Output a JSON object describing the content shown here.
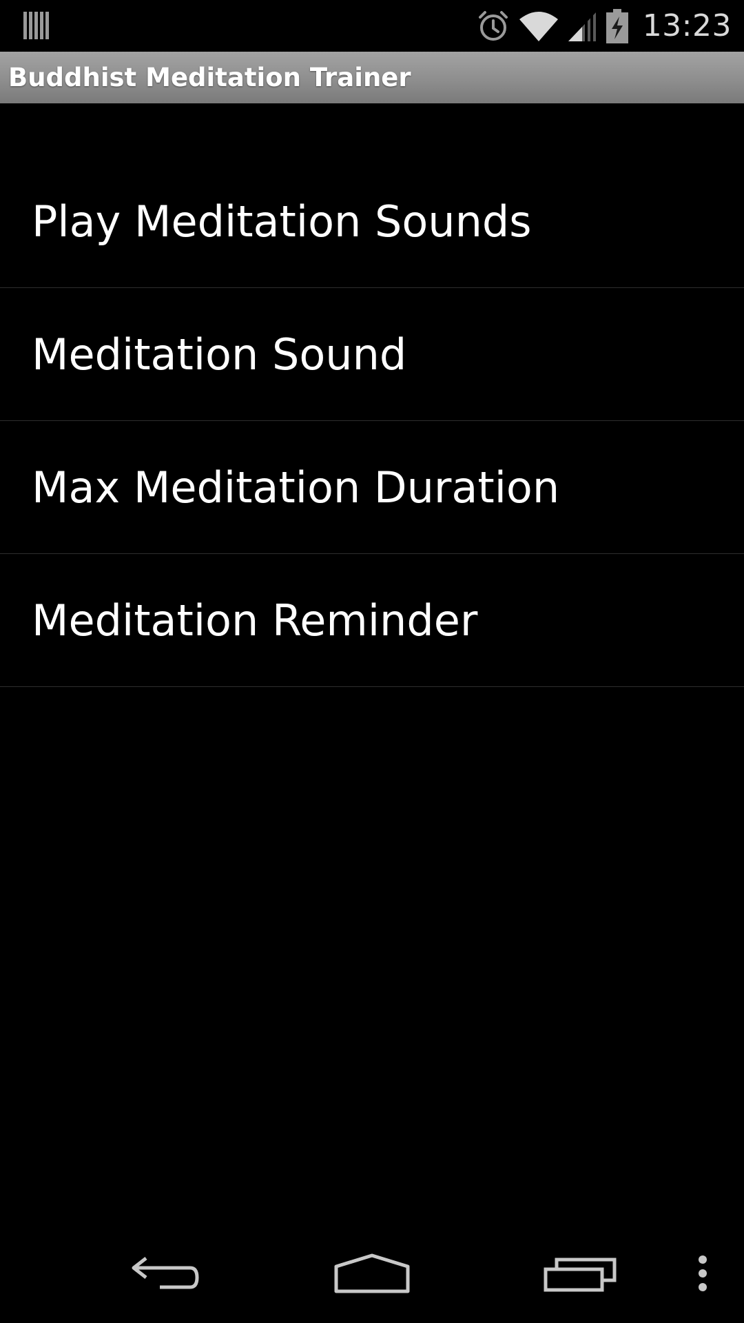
{
  "status_bar": {
    "time": "13:23",
    "icons": [
      "notification-bars-icon",
      "alarm-icon",
      "wifi-icon",
      "signal-icon",
      "battery-charging-icon"
    ]
  },
  "title_bar": {
    "title": "Buddhist Meditation Trainer"
  },
  "preferences": [
    {
      "label": "Play Meditation Sounds"
    },
    {
      "label": "Meditation Sound"
    },
    {
      "label": "Max Meditation Duration"
    },
    {
      "label": "Meditation Reminder"
    }
  ],
  "nav_bar": {
    "buttons": [
      "back-icon",
      "home-icon",
      "recent-apps-icon",
      "overflow-menu-icon"
    ]
  },
  "colors": {
    "background": "#000000",
    "title_bar": "#8e8e8e",
    "divider": "#2e2e2e",
    "text": "#ffffff"
  }
}
